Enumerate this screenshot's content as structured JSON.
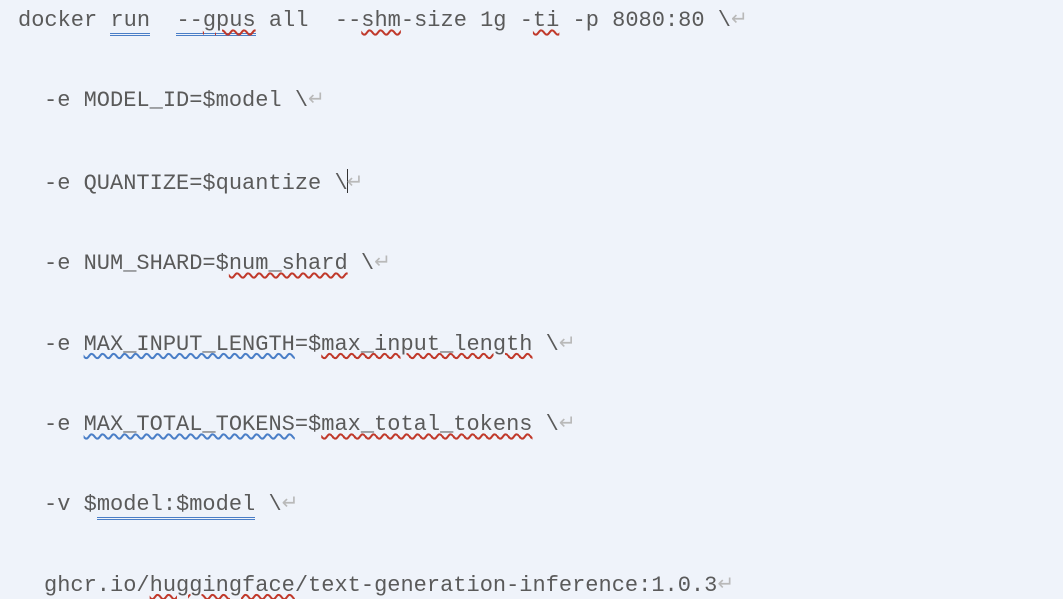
{
  "glyphs": {
    "nl": "↵"
  },
  "lines": {
    "l1": {
      "p1": "docker ",
      "run": "run",
      "sp1": "  ",
      "gpus_dash": "--",
      "gpus": "gpus",
      "rest1": " all  --",
      "shm": "shm",
      "rest2": "-size 1g -",
      "ti": "ti",
      "rest3": " -p 8080:80 \\"
    },
    "l2": {
      "pre": "-e MODEL_ID=$model \\"
    },
    "l3": {
      "pre": "-e QUANTIZE=$quantize \\"
    },
    "l4": {
      "pre": "-e NUM_SHARD=$",
      "var": "num_shard",
      "post": " \\"
    },
    "l5": {
      "pre1": "-e ",
      "mil": "MAX_INPUT_LENGTH",
      "pre2": "=$",
      "var": "max_input_length",
      "post": " \\"
    },
    "l6": {
      "pre1": "-e ",
      "mtt": "MAX_TOTAL_TOKENS",
      "pre2": "=$",
      "var": "max_total_tokens",
      "post": " \\"
    },
    "l7": {
      "pre": "-v $",
      "m1": "model:$model",
      "post": " \\"
    },
    "l8": {
      "pre": "ghcr.io/",
      "hf": "huggingface",
      "post": "/text-generation-inference:1.0.3"
    }
  }
}
